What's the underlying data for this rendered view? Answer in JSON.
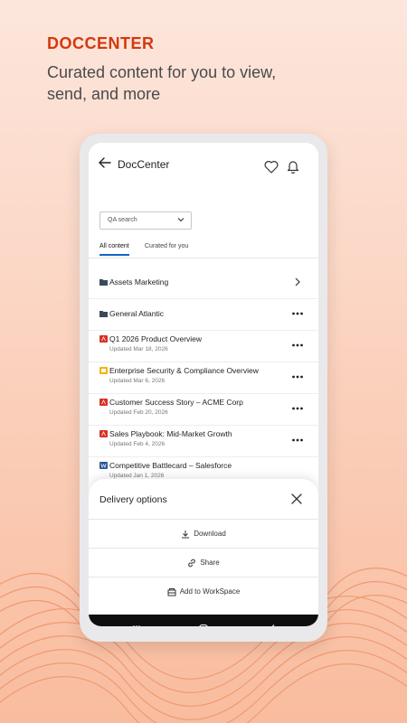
{
  "hero": {
    "kicker": "DOCCENTER",
    "subtitle": "Curated content for you to view, send, and more"
  },
  "app": {
    "title": "DocCenter",
    "search_select": "QA search",
    "tabs": [
      {
        "label": "All content",
        "active": true
      },
      {
        "label": "Curated for you",
        "active": false
      }
    ],
    "items": [
      {
        "icon": "folder-icon",
        "title": "Assets Marketing",
        "updated": "",
        "action": "chevron"
      },
      {
        "icon": "folder-icon",
        "title": "General Atlantic",
        "updated": "",
        "action": "more"
      },
      {
        "icon": "pdf-icon",
        "title": "Q1 2026 Product Overview",
        "updated": "Updated Mar 18, 2026",
        "action": "more"
      },
      {
        "icon": "slides-icon",
        "title": "Enterprise Security & Compliance Overview",
        "updated": "Updated Mar 6, 2026",
        "action": "more"
      },
      {
        "icon": "pdf-icon",
        "title": "Customer Success Story – ACME Corp",
        "updated": "Updated Feb 20, 2026",
        "action": "more"
      },
      {
        "icon": "pdf-icon",
        "title": "Sales Playbook: Mid-Market Growth",
        "updated": "Updated Feb 4, 2026",
        "action": "more"
      },
      {
        "icon": "word-icon",
        "title": "Competitive Battlecard – Salesforce",
        "updated": "Updated Jan 1, 2026",
        "action": "more"
      }
    ]
  },
  "sheet": {
    "title": "Delivery options",
    "options": [
      {
        "label": "Download",
        "icon": "download-icon"
      },
      {
        "label": "Share",
        "icon": "link-icon"
      },
      {
        "label": "Add to WorkSpace",
        "icon": "workspace-icon"
      }
    ]
  },
  "colors": {
    "accent": "#d4380d",
    "tab_underline": "#1565c0",
    "folder": "#3b4a5a",
    "pdf": "#d93025",
    "slides": "#f4b400",
    "word": "#2b579a",
    "navbar": "#0f0f10"
  }
}
